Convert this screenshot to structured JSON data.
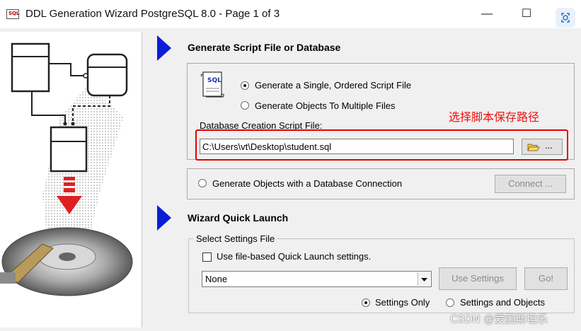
{
  "window": {
    "title": "DDL Generation Wizard PostgreSQL 8.0 - Page 1 of 3",
    "app_icon_text": "SQL",
    "minimize_glyph": "—",
    "maximize_glyph": "☐"
  },
  "section1": {
    "title": "Generate Script File or Database",
    "sql_icon_text": "SQL",
    "option_single": "Generate a Single, Ordered Script File",
    "option_multiple": "Generate Objects To Multiple Files",
    "selected": "single",
    "file_label": "Database Creation Script File:",
    "file_value": "C:\\Users\\vt\\Desktop\\student.sql",
    "browse_label": "..."
  },
  "annotation": {
    "text": "选择脚本保存路径",
    "color": "#f01010"
  },
  "section2": {
    "option_label": "Generate Objects with a Database Connection",
    "connect_label": "Connect ..."
  },
  "section3": {
    "title": "Wizard Quick Launch",
    "group_label": "Select Settings File",
    "checkbox_label": "Use file-based Quick Launch settings.",
    "select_value": "None",
    "use_settings_label": "Use Settings",
    "go_label": "Go!",
    "radio_settings_only": "Settings Only",
    "radio_settings_objects": "Settings and Objects",
    "selected": "settings_only"
  },
  "watermark": "CSDN @爱因斯坦乐",
  "colors": {
    "accent_arrow": "#0a1ed6",
    "highlight_border": "#e60000"
  }
}
